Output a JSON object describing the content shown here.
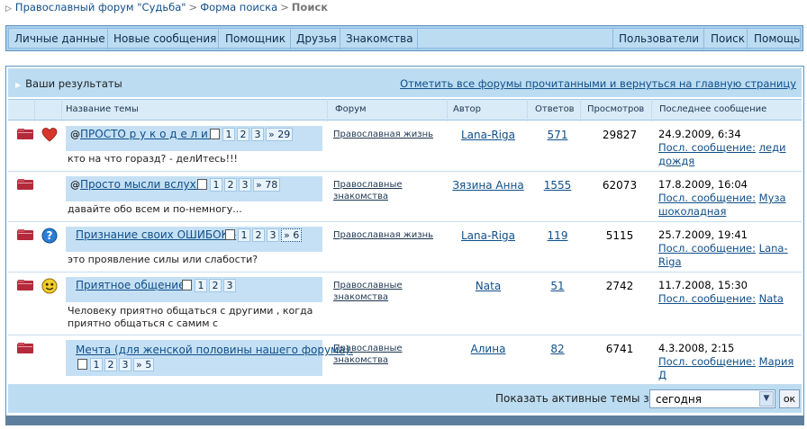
{
  "breadcrumb": {
    "root": "Православный форум \"Судьба\"",
    "middle": "Форма поиска",
    "current": "Поиск",
    "separator": ">"
  },
  "navbar": {
    "left": [
      "Личные данные",
      "Новые сообщения",
      "Помощник",
      "Друзья",
      "Знакомства"
    ],
    "right": [
      "Пользователи",
      "Поиск",
      "Помощь"
    ]
  },
  "results": {
    "title": "Ваши результаты",
    "mark_read": "Отметить все форумы прочитанными и вернуться на главную страницу"
  },
  "columns": {
    "topic": "Название темы",
    "forum": "Форум",
    "author": "Автор",
    "replies": "Ответов",
    "views": "Просмотров",
    "last": "Последнее сообщение"
  },
  "rows": [
    {
      "icon": "heart-icon",
      "pin": "@",
      "title": "ПРОСТО р у к о д е л и е",
      "pages": [
        "1",
        "2",
        "3",
        "» 29"
      ],
      "desc": "кто на что горазд? - делИтесь!!!",
      "forum": "Православная жизнь",
      "author": "Lana-Riga",
      "replies": "571",
      "views": "29827",
      "last_date": "24.9.2009, 6:34",
      "last_label": "Посл. сообщение:",
      "last_user": "леди дождя"
    },
    {
      "icon": "",
      "pin": "@",
      "title": "Просто мысли вслух...",
      "pages": [
        "1",
        "2",
        "3",
        "» 78"
      ],
      "desc": "давайте обо всем и по-немногу...",
      "forum": "Православные знакомства",
      "author": "Зязина Анна",
      "replies": "1555",
      "views": "62073",
      "last_date": "17.8.2009, 16:04",
      "last_label": "Посл. сообщение:",
      "last_user": "Муза шоколадная"
    },
    {
      "icon": "question-icon",
      "pin": "",
      "title": "Признание своих ОШИБОК -",
      "pages": [
        "1",
        "2",
        "3",
        "» 6"
      ],
      "desc": "это проявление силы или слабости?",
      "forum": "Православная жизнь",
      "author": "Lana-Riga",
      "replies": "119",
      "views": "5115",
      "last_date": "25.7.2009, 19:41",
      "last_label": "Посл. сообщение:",
      "last_user": "Lana-Riga"
    },
    {
      "icon": "smile-icon",
      "pin": "",
      "title": "Приятное общение",
      "pages": [
        "1",
        "2",
        "3"
      ],
      "desc": "Человеку приятно общаться с другими , когда приятно общаться с самим с",
      "forum": "Православные знакомства",
      "author": "Nata",
      "replies": "51",
      "views": "2742",
      "last_date": "11.7.2008, 15:30",
      "last_label": "Посл. сообщение:",
      "last_user": "Nata"
    },
    {
      "icon": "",
      "pin": "",
      "title": "Мечта (для женской половины нашего форума).",
      "pages": [
        "1",
        "2",
        "3",
        "» 5"
      ],
      "desc": "",
      "forum": "Православные знакомства",
      "author": "Алина",
      "replies": "82",
      "views": "6741",
      "last_date": "4.3.2008, 2:15",
      "last_label": "Посл. сообщение:",
      "last_user": "Мария Д"
    }
  ],
  "footer": {
    "label": "Показать активные темы за:",
    "select_value": "сегодня",
    "ok": "ок"
  },
  "colors": {
    "nav_bg": "#bcdcf2",
    "link": "#104f8a",
    "folder": "#b32a3a"
  }
}
